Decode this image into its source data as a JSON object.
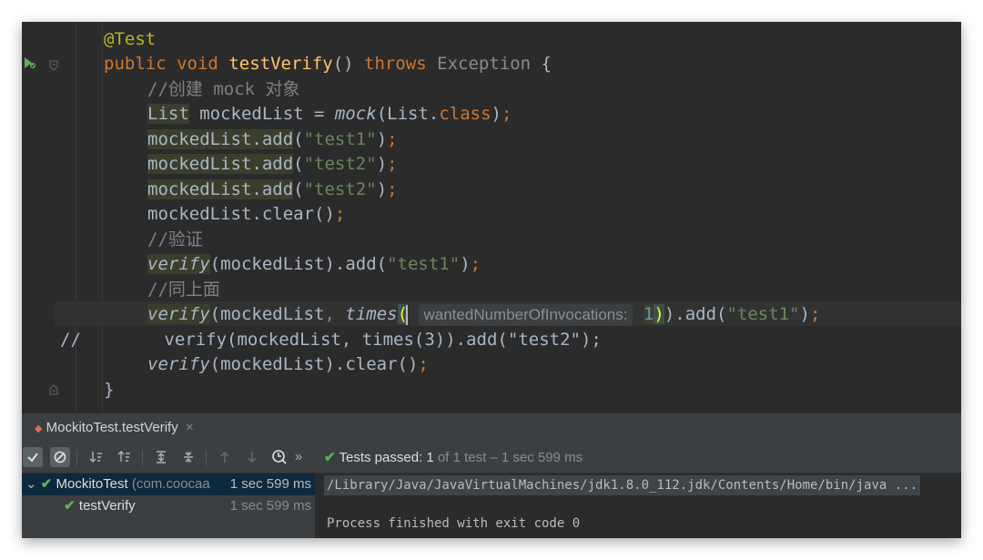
{
  "editor": {
    "lines": {
      "l1": {
        "annotation": "@Test"
      },
      "l2": {
        "kw_public": "public",
        "kw_void": "void",
        "method": "testVerify",
        "parens": "()",
        "kw_throws": "throws",
        "exception": "Exception",
        "brace": "{"
      },
      "l3": {
        "comment": "//创建 mock 对象"
      },
      "l4": {
        "type": "List",
        "rest1": " mockedList = ",
        "mock": "mock",
        "rest2": "(List.",
        "kw_class": "class",
        "rest3": ")",
        "semi": ";"
      },
      "l5": {
        "target": "mockedList.add",
        "open": "(",
        "str": "\"test1\"",
        "close": ")",
        "semi": ";"
      },
      "l6": {
        "target": "mockedList.add",
        "open": "(",
        "str": "\"test2\"",
        "close": ")",
        "semi": ";"
      },
      "l7": {
        "target": "mockedList.add",
        "open": "(",
        "str": "\"test2\"",
        "close": ")",
        "semi": ";"
      },
      "l8": {
        "text": "mockedList.clear()",
        "semi": ";"
      },
      "l9": {
        "comment": "//验证"
      },
      "l10": {
        "verify": "verify",
        "mid": "(mockedList).add(",
        "str": "\"test1\"",
        "close": ")",
        "semi": ";"
      },
      "l11": {
        "comment": "//同上面"
      },
      "l12": {
        "verify": "verify",
        "mid": "(mockedList",
        "comma": ",",
        "times": "times",
        "paren": "(",
        "hint": "wantedNumberOfInvocations:",
        "num": "1",
        "close1": ")",
        "mid2": ").add(",
        "str": "\"test1\"",
        "close2": ")",
        "semi": ";"
      },
      "l13": {
        "text": "//        verify(mockedList, times(3)).add(\"test2\");"
      },
      "l14": {
        "verify": "verify",
        "mid": "(mockedList).clear()",
        "semi": ";"
      },
      "l15": {
        "brace": "}"
      }
    }
  },
  "tool_window": {
    "tab_label": "MockitoTest.testVerify",
    "close": "×",
    "status_prefix": "Tests passed:",
    "status_count": "1",
    "status_rest": "of 1 test – 1 sec 599 ms",
    "toolbar_more": "»",
    "tree": [
      {
        "name": "MockitoTest",
        "package": "(com.coocaa",
        "time": "1 sec 599 ms"
      },
      {
        "name": "testVerify",
        "time": "1 sec 599 ms"
      }
    ],
    "console": [
      "/Library/Java/JavaVirtualMachines/jdk1.8.0_112.jdk/Contents/Home/bin/java ...",
      "Process finished with exit code 0"
    ]
  },
  "colors": {
    "editor_bg": "#2b2b2b",
    "keyword": "#cc7832",
    "annotation": "#bbb529",
    "string": "#6a8759",
    "method": "#ffc66d",
    "pass_green": "#5fb05f"
  }
}
